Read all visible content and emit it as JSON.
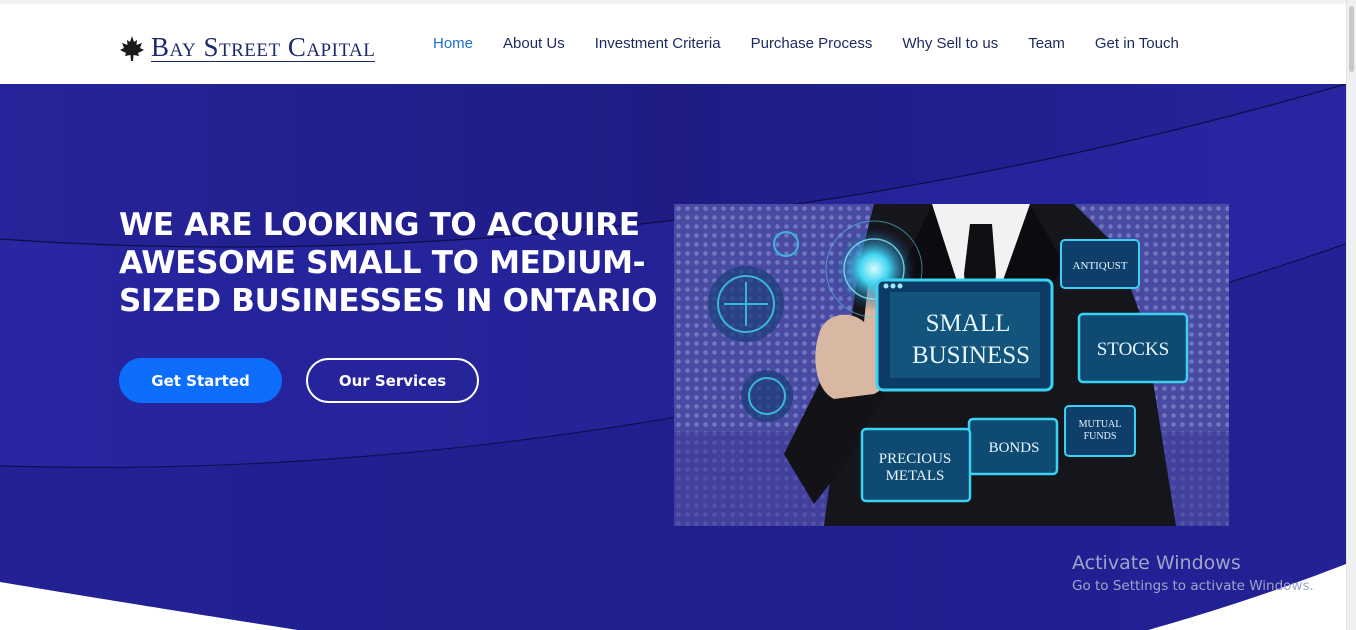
{
  "brand": {
    "name": "Bay Street Capital",
    "logo_icon": "maple-leaf-icon"
  },
  "nav": {
    "items": [
      {
        "label": "Home",
        "active": true
      },
      {
        "label": "About Us"
      },
      {
        "label": "Investment Criteria"
      },
      {
        "label": "Purchase Process"
      },
      {
        "label": "Why Sell to us"
      },
      {
        "label": "Team"
      },
      {
        "label": "Get in Touch"
      }
    ]
  },
  "hero": {
    "headline": "WE ARE LOOKING TO ACQUIRE AWESOME SMALL TO MEDIUM-SIZED BUSINESSES IN ONTARIO",
    "primary_button": "Get Started",
    "secondary_button": "Our Services",
    "image": {
      "labels": {
        "main": [
          "SMALL",
          "BUSINESS"
        ],
        "antique": "ANTIQUST",
        "stocks": "STOCKS",
        "mutual": [
          "MUTUAL",
          "FUNDS"
        ],
        "bonds": "BONDS",
        "metals": [
          "PRECIOUS",
          "METALS"
        ]
      }
    }
  },
  "watermark": {
    "title": "Activate Windows",
    "subtitle": "Go to Settings to activate Windows."
  },
  "colors": {
    "hero_bg": "#23208a",
    "accent": "#0d6efd",
    "nav_text": "#1a2a5e",
    "nav_active": "#1d6fd6",
    "brand": "#1c2a6b"
  }
}
